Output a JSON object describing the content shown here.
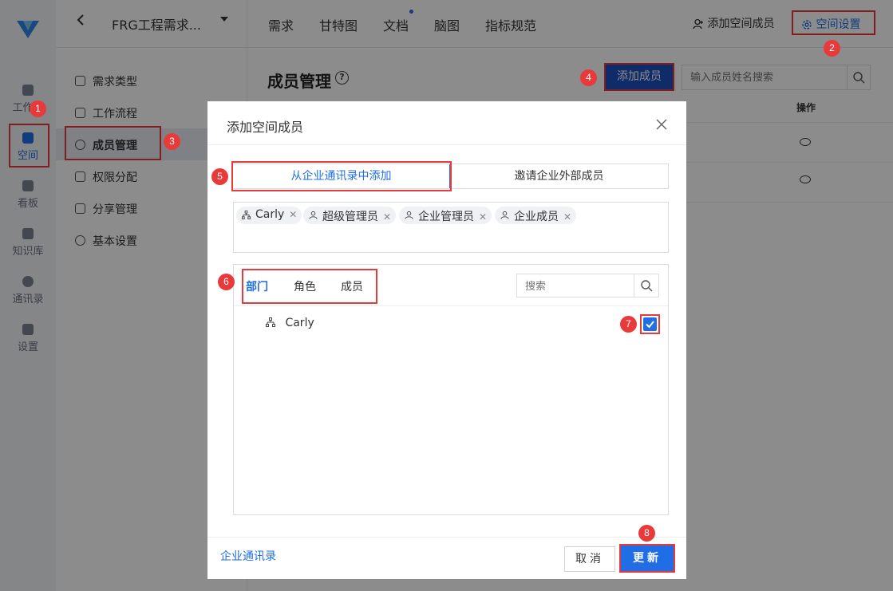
{
  "rail": {
    "items": [
      {
        "label": "工作台"
      },
      {
        "label": "空间"
      },
      {
        "label": "看板"
      },
      {
        "label": "知识库"
      },
      {
        "label": "通讯录"
      },
      {
        "label": "设置"
      }
    ]
  },
  "topbar": {
    "back_icon": "chevron-left-icon",
    "project": "FRG工程需求...",
    "tabs": [
      "需求",
      "甘特图",
      "文档",
      "脑图",
      "指标规范"
    ],
    "add_space_member": "添加空间成员",
    "space_settings": "空间设置"
  },
  "subnav": {
    "items": [
      {
        "label": "需求类型",
        "icon": "grid-icon"
      },
      {
        "label": "工作流程",
        "icon": "flow-icon"
      },
      {
        "label": "成员管理",
        "icon": "user-icon"
      },
      {
        "label": "权限分配",
        "icon": "lock-icon"
      },
      {
        "label": "分享管理",
        "icon": "share-icon"
      },
      {
        "label": "基本设置",
        "icon": "gear-icon"
      }
    ],
    "active": "成员管理"
  },
  "main": {
    "title": "成员管理",
    "add_member": "添加成员",
    "search_placeholder": "输入成员姓名搜索",
    "col_operation": "操作"
  },
  "modal": {
    "title": "添加空间成员",
    "tabs": [
      "从企业通讯录中添加",
      "邀请企业外部成员"
    ],
    "chips": [
      {
        "label": "Carly",
        "icon": "org-icon"
      },
      {
        "label": "超级管理员",
        "icon": "user-icon"
      },
      {
        "label": "企业管理员",
        "icon": "user-icon"
      },
      {
        "label": "企业成员",
        "icon": "user-icon"
      }
    ],
    "picker_tabs": [
      "部门",
      "角色",
      "成员"
    ],
    "picker_search_placeholder": "搜索",
    "tree_item": "Carly",
    "contacts_link": "企业通讯录",
    "cancel": "取消",
    "update": "更新"
  },
  "badges": [
    "1",
    "2",
    "3",
    "4",
    "5",
    "6",
    "7",
    "8"
  ],
  "colors": {
    "accent": "#1f6ee5",
    "highlight": "#e83a3a",
    "button_dark": "#1d4fc0"
  }
}
